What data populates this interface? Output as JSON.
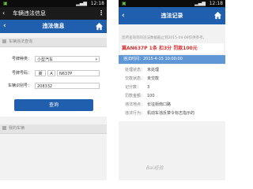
{
  "left": {
    "statusbar": {
      "time": "12:18"
    },
    "appbar": {
      "title": "车辆违法信息"
    },
    "titlebar": {
      "title": "违法信息"
    },
    "section_query": "车辆违法查询",
    "form": {
      "car_type_label": "号牌种类：",
      "car_type_value": "小型汽车",
      "plate_label": "号牌号码：",
      "plate_prefix": "冀",
      "plate_letter": "A",
      "plate_value": "N637P",
      "vin_label": "车辆识别号：",
      "vin_value": "208332"
    },
    "query_button": "查询",
    "section_mycars": "我的车辆"
  },
  "right": {
    "statusbar": {
      "time": "12:18"
    },
    "titlebar": {
      "title": "违法记录"
    },
    "notice": "您所查询到的违法数据截止到2015-04-09仅供参考。",
    "record_head": "冀AN637P 1条 扣3分 罚款100元",
    "record_time": "违法时间：2015-4-15 10:00:00",
    "details": [
      {
        "k": "处理状态：",
        "v": "未处理"
      },
      {
        "k": "交款状态：",
        "v": "未交款"
      },
      {
        "k": "记分数：",
        "v": "3"
      },
      {
        "k": "罚款金额：",
        "v": "100"
      },
      {
        "k": "违法地点：",
        "v": "长征街南口路"
      },
      {
        "k": "违法行为：",
        "v": "机动车违反禁令标志指示的"
      }
    ]
  },
  "watermark": "Bai经验"
}
